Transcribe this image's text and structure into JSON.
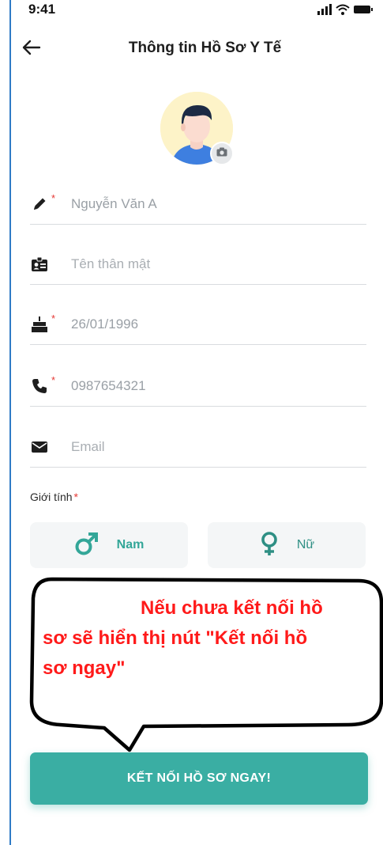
{
  "status_bar": {
    "time": "9:41",
    "icons": [
      "signal-icon",
      "wifi-icon",
      "battery-icon"
    ]
  },
  "header": {
    "back_icon": "arrow-left-icon",
    "title": "Thông tin Hồ Sơ Y Tế"
  },
  "avatar": {
    "camera_icon": "camera-icon"
  },
  "form": {
    "full_name": {
      "icon": "pencil-icon",
      "required": "*",
      "value": "Nguyễn Văn A"
    },
    "nickname": {
      "icon": "id-card-icon",
      "required": "",
      "placeholder": "Tên thân mật"
    },
    "birthday": {
      "icon": "cake-icon",
      "required": "*",
      "value": "26/01/1996"
    },
    "phone": {
      "icon": "phone-icon",
      "required": "*",
      "value": "0987654321"
    },
    "email": {
      "icon": "mail-icon",
      "required": "",
      "placeholder": "Email"
    },
    "gender": {
      "label": "Giới tính",
      "required": "*",
      "options": [
        {
          "icon": "male-icon",
          "label": "Nam"
        },
        {
          "icon": "female-icon",
          "label": "Nữ"
        }
      ]
    }
  },
  "annotation": {
    "line1": "Nếu chưa kết nối hồ",
    "line2": "sơ sẽ hiển thị nút \"Kết nối hồ",
    "line3": "sơ ngay\""
  },
  "cta": {
    "label": "KẾT NỐI HỒ SƠ NGAY!"
  },
  "colors": {
    "accent": "#3aaea3",
    "required": "#e53935",
    "annotation_text": "#ff1a1a",
    "avatar_bg": "#fdf3c8"
  }
}
